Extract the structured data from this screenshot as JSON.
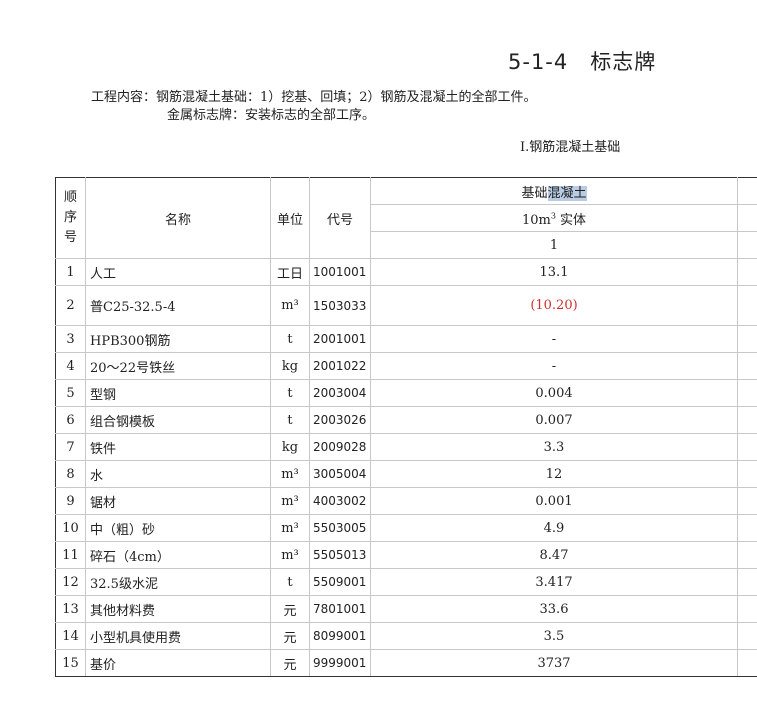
{
  "title": {
    "code": "5-1-4",
    "name": "标志牌"
  },
  "work_content": {
    "line1": "工程内容：钢筋混凝土基础：1）挖基、回填；2）钢筋及混凝土的全部工件。",
    "line2": "金属标志牌：安装标志的全部工序。"
  },
  "section_title": "I.钢筋混凝土基础",
  "table": {
    "headers": {
      "index_chars": [
        "顺",
        "序",
        "号"
      ],
      "name": "名称",
      "unit": "单位",
      "code": "代号",
      "item_base": "基础",
      "item_highlight": "混凝土",
      "measure_prefix": "10m",
      "measure_sup": "3",
      "measure_suffix": " 实体",
      "column_number": "1"
    },
    "rows": [
      {
        "idx": "1",
        "name": "人工",
        "unit": "工日",
        "code": "1001001",
        "value": "13.1"
      },
      {
        "idx": "2",
        "name": "普C25-32.5-4",
        "unit": "m³",
        "code": "1503033",
        "value": "(10.20)",
        "value_color": "#d03030"
      },
      {
        "idx": "3",
        "name": "HPB300钢筋",
        "unit": "t",
        "code": "2001001",
        "value": "-"
      },
      {
        "idx": "4",
        "name": "20～22号铁丝",
        "unit": "kg",
        "code": "2001022",
        "value": "-"
      },
      {
        "idx": "5",
        "name": "型钢",
        "unit": "t",
        "code": "2003004",
        "value": "0.004"
      },
      {
        "idx": "6",
        "name": "组合钢模板",
        "unit": "t",
        "code": "2003026",
        "value": "0.007"
      },
      {
        "idx": "7",
        "name": "铁件",
        "unit": "kg",
        "code": "2009028",
        "value": "3.3"
      },
      {
        "idx": "8",
        "name": "水",
        "unit": "m³",
        "code": "3005004",
        "value": "12"
      },
      {
        "idx": "9",
        "name": "锯材",
        "unit": "m³",
        "code": "4003002",
        "value": "0.001"
      },
      {
        "idx": "10",
        "name": "中（粗）砂",
        "unit": "m³",
        "code": "5503005",
        "value": "4.9"
      },
      {
        "idx": "11",
        "name": "碎石（4cm）",
        "unit": "m³",
        "code": "5505013",
        "value": "8.47"
      },
      {
        "idx": "12",
        "name": "32.5级水泥",
        "unit": "t",
        "code": "5509001",
        "value": "3.417"
      },
      {
        "idx": "13",
        "name": "其他材料费",
        "unit": "元",
        "code": "7801001",
        "value": "33.6"
      },
      {
        "idx": "14",
        "name": "小型机具使用费",
        "unit": "元",
        "code": "8099001",
        "value": "3.5"
      },
      {
        "idx": "15",
        "name": "基价",
        "unit": "元",
        "code": "9999001",
        "value": "3737"
      }
    ]
  }
}
